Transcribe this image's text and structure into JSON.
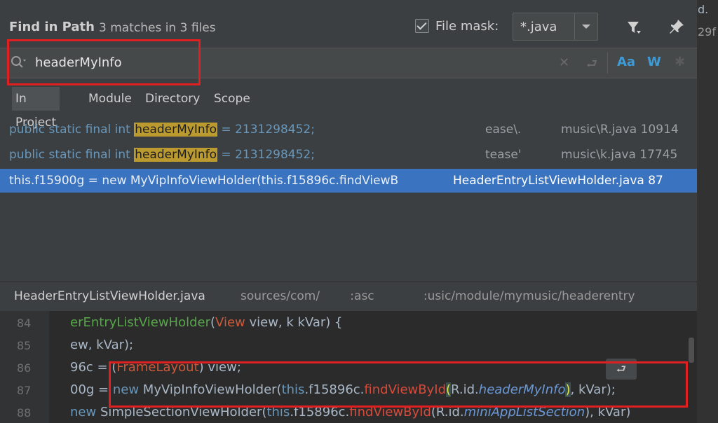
{
  "dialog": {
    "title": "Find in Path",
    "matches": "3 matches in 3 files",
    "file_mask_label": "File mask:",
    "file_mask_value": "*.java"
  },
  "search": {
    "query": "headerMyInfo",
    "opt_case": "Aa",
    "opt_words": "W"
  },
  "scopes": [
    "In Project",
    "Module",
    "Directory",
    "Scope"
  ],
  "results": [
    {
      "prefix": "public static final int ",
      "match": "headerMyInfo",
      "suffix": " = 2131298452;",
      "path_a": "ease\\.",
      "path_b": "music\\R.java 10914"
    },
    {
      "prefix": "public static final int ",
      "match": "headerMyInfo",
      "suffix": " = 2131298452;",
      "path_a": "tease'",
      "path_b": "music\\k.java 17745"
    },
    {
      "code": "this.f15900g = new MyVipInfoViewHolder(this.f15896c.findViewB",
      "file": "HeaderEntryListViewHolder.java 87"
    }
  ],
  "preview": {
    "file": "HeaderEntryListViewHolder.java",
    "path": "sources/com/        :asc             :usic/module/mymusic/headerentry"
  },
  "editor": {
    "line_numbers": [
      "84",
      "85",
      "86",
      "87",
      "88"
    ],
    "l84": {
      "a": "erEntryListViewHolder",
      "b": "(",
      "c": "View",
      "d": " view, k kVar) {"
    },
    "l85": {
      "a": "ew, kVar);"
    },
    "l86": {
      "a": "96c = (",
      "b": "FrameLayout",
      "c": ") view;"
    },
    "l87": {
      "a": "00g = ",
      "b": "new",
      "c": " MyVipInfoViewHolder(",
      "d": "this",
      "e": ".f15896c.",
      "f": "findViewById",
      "g": "(",
      "h": "R.id.",
      "i": "headerMyInfo",
      "j": ")",
      "k": ", kVar);"
    },
    "l88": {
      "a": "new",
      "b": " SimpleSectionViewHolder(",
      "c": "this",
      "d": ".f15896c.",
      "e": "findViewById",
      "f": "(R.id.",
      "g": "miniAppListSection",
      "h": "), kVar)"
    }
  },
  "background_edge": {
    "t1": "d.",
    "t2": "29f"
  },
  "colors": {
    "accent": "#3d9bd8",
    "selection": "#3a73c0",
    "highlight": "#bb9a30",
    "annotation": "#e02020"
  }
}
